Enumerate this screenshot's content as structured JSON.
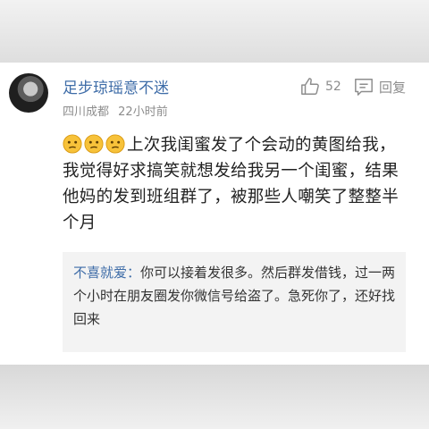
{
  "comment": {
    "username": "足步琼瑶意不迷",
    "location": "四川成都",
    "time": "22小时前",
    "likes": "52",
    "reply_label": "回复",
    "emojis": [
      "confused-face-icon",
      "confused-face-icon",
      "confused-face-icon"
    ],
    "text": "上次我闺蜜发了个会动的黄图给我，我觉得好求搞笑就想发给我另一个闺蜜，结果他妈的发到班组群了，被那些人嘲笑了整整半个月"
  },
  "quoted_reply": {
    "username": "不喜就爱：",
    "text": "你可以接着发很多。然后群发借钱，过一两个小时在朋友圈发你微信号给盗了。急死你了，还好找回来"
  },
  "colors": {
    "link": "#3f6da8",
    "meta": "#8d8d8d",
    "quote_bg": "#f3f3f3"
  }
}
